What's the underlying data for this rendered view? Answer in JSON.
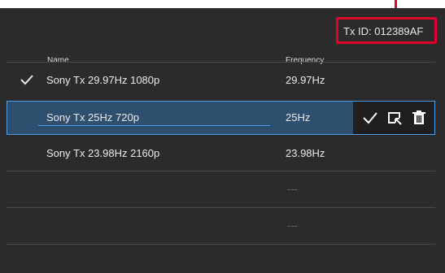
{
  "txid": "Tx ID: 012389AF",
  "columns": {
    "name": "Name",
    "frequency": "Frequency"
  },
  "rows": [
    {
      "name": "Sony Tx 29.97Hz 1080p",
      "frequency": "29.97Hz"
    },
    {
      "name": "Sony Tx 25Hz 720p",
      "frequency": "25Hz"
    },
    {
      "name": "Sony Tx 23.98Hz 2160p",
      "frequency": "23.98Hz"
    },
    {
      "name": "",
      "frequency": "---"
    },
    {
      "name": "",
      "frequency": "---"
    }
  ],
  "icons": [
    "check-icon",
    "confirm-icon",
    "select-icon",
    "trash-icon"
  ],
  "colors": {
    "panel": "#2b2b2b",
    "highlight": "#e0002a",
    "selection_border": "#4aa0e8",
    "selection_bg": "#2f4f6f"
  }
}
